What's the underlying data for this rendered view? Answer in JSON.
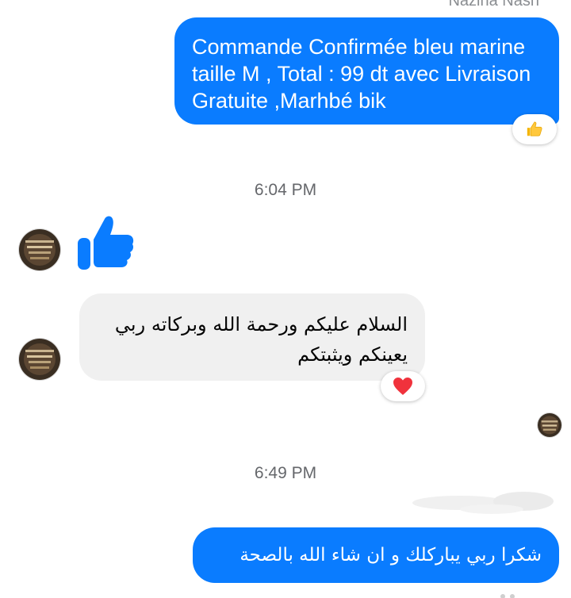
{
  "conversation": {
    "sender_name": "Nazina Nash",
    "messages": [
      {
        "direction": "outgoing",
        "text": "Commande Confirmée bleu marine taille M , Total : 99 dt avec Livraison Gratuite ,Marhbé bik",
        "reaction_icon": "thumbs-up-emoji"
      },
      {
        "timestamp": "6:04 PM"
      },
      {
        "direction": "incoming",
        "type": "sticker",
        "icon": "thumbs-up-sticker"
      },
      {
        "direction": "incoming",
        "text": "السلام عليكم ورحمة الله وبركاته  ربي يعينكم ويثبتكم",
        "reaction_icon": "red-heart-emoji"
      },
      {
        "timestamp": "6:49 PM"
      },
      {
        "direction": "outgoing",
        "text": "شكرا ربي يباركلك و ان شاء الله بالصحة"
      }
    ]
  },
  "colors": {
    "outgoing_bubble": "#0a7cff",
    "incoming_bubble": "#f0f0f0",
    "timestamp_text": "#65676b"
  }
}
